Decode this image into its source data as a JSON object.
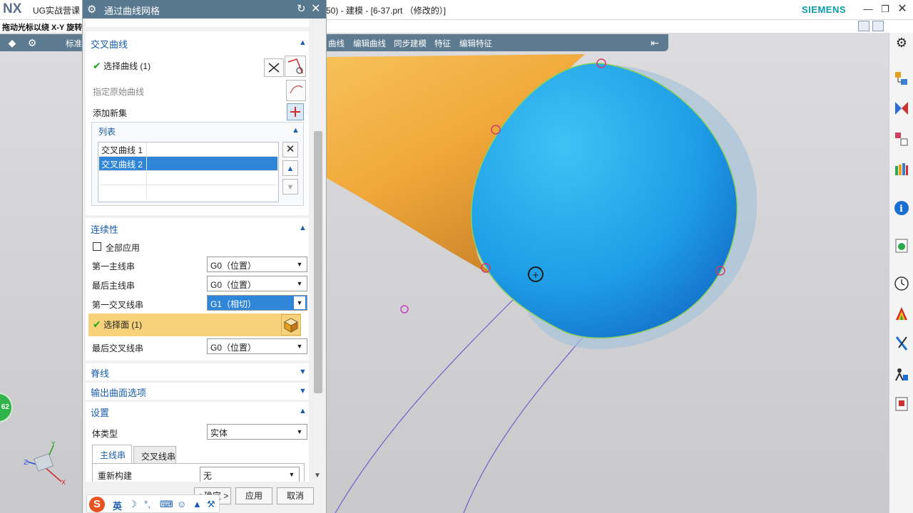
{
  "titlebar": {
    "logo": "NX",
    "left_title": "UG实战营课",
    "right_title": "50) - 建模 - [6-37.prt （修改的）]",
    "brand": "SIEMENS"
  },
  "statusbar": {
    "prompt": "拖动光标以绕 X-Y 旋转"
  },
  "ribbon": {
    "items": [
      "标准",
      "曲线",
      "编辑曲线",
      "同步建模",
      "特征",
      "编辑特征"
    ]
  },
  "dialog": {
    "title": "通过曲线网格",
    "sections": {
      "cross_curves": {
        "title": "交叉曲线",
        "select_curve": "选择曲线 (1)",
        "specify_origin": "指定原始曲线",
        "add_new_set": "添加新集",
        "list": {
          "title": "列表",
          "rows": [
            "交叉曲线 1",
            "交叉曲线 2"
          ]
        }
      },
      "continuity": {
        "title": "连续性",
        "apply_all": "全部应用",
        "first_primary_label": "第一主线串",
        "first_primary_value": "G0（位置）",
        "last_primary_label": "最后主线串",
        "last_primary_value": "G0（位置）",
        "first_cross_label": "第一交叉线串",
        "first_cross_value": "G1（相切）",
        "select_face": "选择面 (1)",
        "last_cross_label": "最后交叉线串",
        "last_cross_value": "G0（位置）"
      },
      "spine": {
        "title": "脊线"
      },
      "output_options": {
        "title": "输出曲面选项"
      },
      "settings": {
        "title": "设置",
        "body_type_label": "体类型",
        "body_type_value": "实体",
        "tabs": [
          "主线串",
          "交叉线串"
        ],
        "rebuild_label": "重新构建",
        "rebuild_value": "无"
      }
    },
    "footer": {
      "ok": "< 确定 >",
      "apply": "应用",
      "cancel": "取消"
    }
  },
  "ime": {
    "mode": "英"
  },
  "badge": {
    "value": "62"
  },
  "colors": {
    "ribbon": "#5c7a90",
    "dialog_header": "#58788f",
    "section_title": "#1a5da8",
    "selection_blue": "#2f86d8",
    "highlight_row": "#f7d27a",
    "tube_orange": "#f0a83a",
    "face_blue": "#1e9de6",
    "brand": "#0a9aa8"
  }
}
